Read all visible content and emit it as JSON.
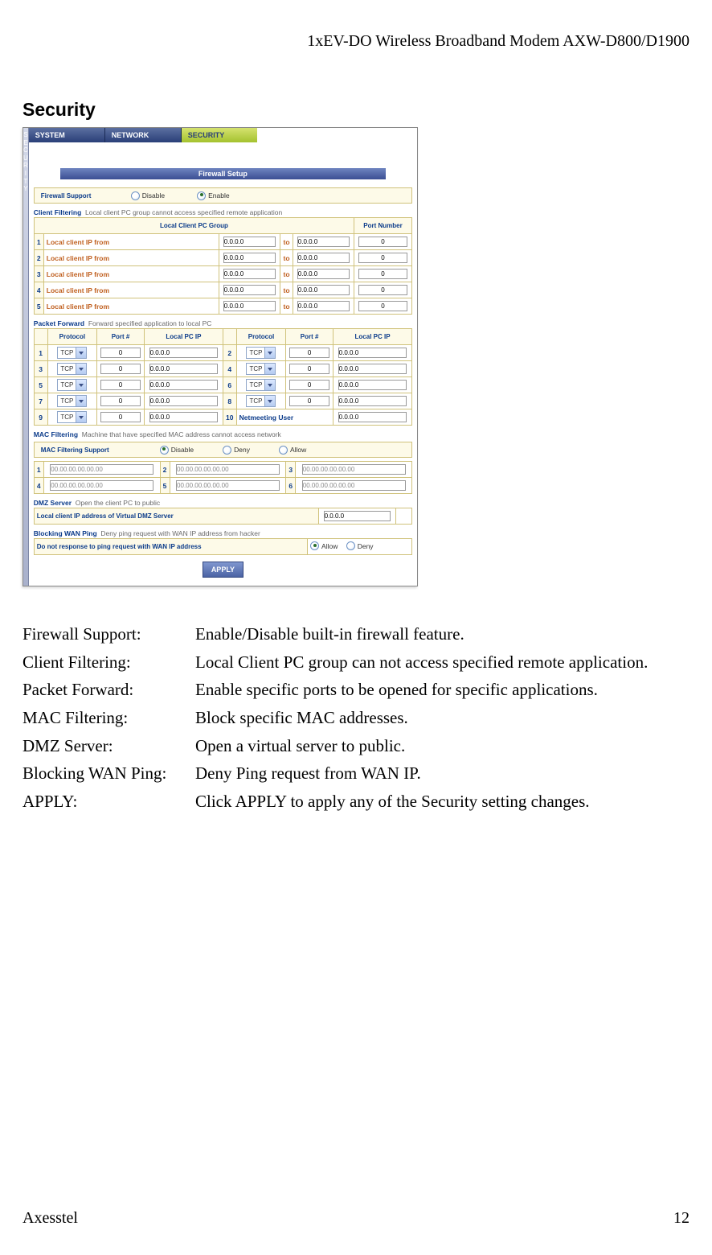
{
  "header": {
    "product": "1xEV-DO Wireless Broadband Modem AXW-D800/D1900"
  },
  "section": {
    "title": "Security"
  },
  "screenshot": {
    "side_tab": [
      "S",
      "E",
      "C",
      "U",
      "R",
      "I",
      "T",
      "Y"
    ],
    "nav": {
      "tabs": [
        "SYSTEM",
        "NETWORK",
        "SECURITY"
      ],
      "active_index": 2
    },
    "firewall_setup": {
      "banner": "Firewall Setup",
      "label": "Firewall Support",
      "disable": "Disable",
      "enable": "Enable",
      "selected": "Enable"
    },
    "client_filtering": {
      "title": "Client Filtering",
      "subtitle": "Local client PC group cannot access specified remote application",
      "th_group": "Local Client PC Group",
      "th_port": "Port Number",
      "from_label": "Local client IP from",
      "to_label": "to",
      "rows": [
        {
          "n": "1",
          "from": "0.0.0.0",
          "to": "0.0.0.0",
          "port": "0"
        },
        {
          "n": "2",
          "from": "0.0.0.0",
          "to": "0.0.0.0",
          "port": "0"
        },
        {
          "n": "3",
          "from": "0.0.0.0",
          "to": "0.0.0.0",
          "port": "0"
        },
        {
          "n": "4",
          "from": "0.0.0.0",
          "to": "0.0.0.0",
          "port": "0"
        },
        {
          "n": "5",
          "from": "0.0.0.0",
          "to": "0.0.0.0",
          "port": "0"
        }
      ]
    },
    "packet_forward": {
      "title": "Packet Forward",
      "subtitle": "Forward specified application to local PC",
      "th_protocol": "Protocol",
      "th_port": "Port #",
      "th_ip": "Local PC IP",
      "protocol_value": "TCP",
      "rows": [
        {
          "n": "1",
          "port": "0",
          "ip": "0.0.0.0"
        },
        {
          "n": "2",
          "port": "0",
          "ip": "0.0.0.0"
        },
        {
          "n": "3",
          "port": "0",
          "ip": "0.0.0.0"
        },
        {
          "n": "4",
          "port": "0",
          "ip": "0.0.0.0"
        },
        {
          "n": "5",
          "port": "0",
          "ip": "0.0.0.0"
        },
        {
          "n": "6",
          "port": "0",
          "ip": "0.0.0.0"
        },
        {
          "n": "7",
          "port": "0",
          "ip": "0.0.0.0"
        },
        {
          "n": "8",
          "port": "0",
          "ip": "0.0.0.0"
        },
        {
          "n": "9",
          "port": "0",
          "ip": "0.0.0.0"
        }
      ],
      "netmeeting": {
        "n": "10",
        "label": "Netmeeting User",
        "ip": "0.0.0.0"
      }
    },
    "mac_filtering": {
      "title": "MAC Filtering",
      "subtitle": "Machine that have specified MAC address cannot access network",
      "support_label": "MAC Filtering Support",
      "opts": {
        "disable": "Disable",
        "deny": "Deny",
        "allow": "Allow"
      },
      "selected": "Disable",
      "rows": [
        {
          "n": "1",
          "mac": "00.00.00.00.00.00"
        },
        {
          "n": "2",
          "mac": "00.00.00.00.00.00"
        },
        {
          "n": "3",
          "mac": "00.00.00.00.00.00"
        },
        {
          "n": "4",
          "mac": "00.00.00.00.00.00"
        },
        {
          "n": "5",
          "mac": "00.00.00.00.00.00"
        },
        {
          "n": "6",
          "mac": "00.00.00.00.00.00"
        }
      ]
    },
    "dmz": {
      "title": "DMZ Server",
      "subtitle": "Open the client PC to public",
      "label": "Local client IP address of Virtual DMZ Server",
      "ip": "0.0.0.0"
    },
    "wan_ping": {
      "title": "Blocking WAN Ping",
      "subtitle": "Deny ping request with WAN IP address from hacker",
      "label": "Do not response to ping request with WAN IP address",
      "allow": "Allow",
      "deny": "Deny",
      "selected": "Allow"
    },
    "apply": "APPLY"
  },
  "descriptions": [
    {
      "term": "Firewall Support:",
      "desc": "Enable/Disable built-in firewall feature."
    },
    {
      "term": "Client Filtering:",
      "desc": "Local Client PC group can not access specified remote application."
    },
    {
      "term": "Packet Forward:",
      "desc": "Enable specific ports to be opened for specific applications."
    },
    {
      "term": "MAC Filtering:",
      "desc": "Block specific MAC addresses."
    },
    {
      "term": "DMZ Server:",
      "desc": "Open a virtual server to public."
    },
    {
      "term": "Blocking WAN Ping:",
      "desc": "Deny Ping request from WAN IP."
    },
    {
      "term": "APPLY:",
      "desc": "Click APPLY to apply any of the Security setting changes."
    }
  ],
  "footer": {
    "left": "Axesstel",
    "right": "12"
  }
}
